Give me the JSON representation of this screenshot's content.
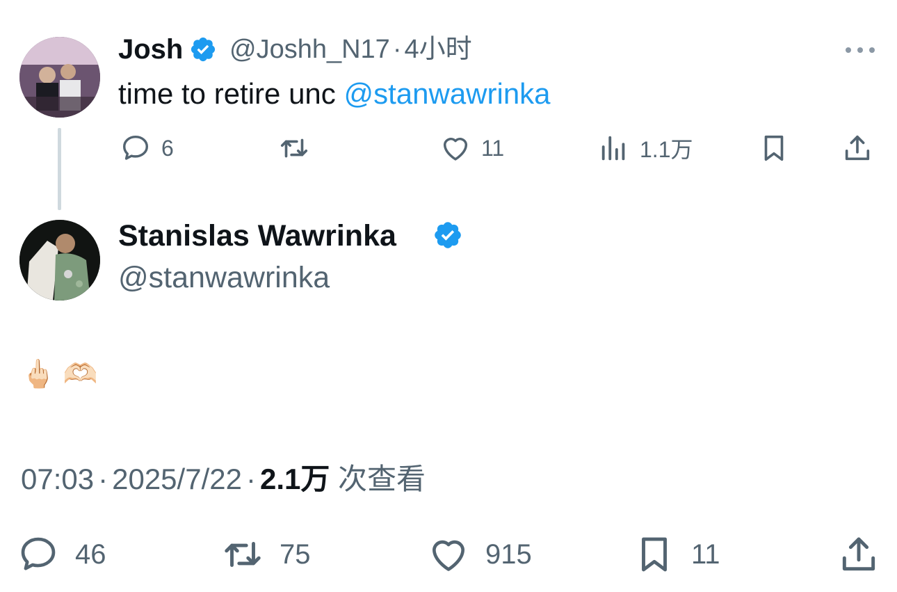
{
  "reply_tweet": {
    "author": {
      "name": "Josh",
      "handle": "@Joshh_N17",
      "separator": "·",
      "time": "4小时",
      "verified": true
    },
    "text_prefix": "time to retire unc ",
    "mention": "@stanwawrinka",
    "actions": {
      "replies": "6",
      "retweets": "",
      "likes": "11",
      "views": "1.1万"
    },
    "icons": [
      "more-icon",
      "reply-icon",
      "retweet-icon",
      "like-icon",
      "views-icon",
      "bookmark-icon",
      "share-icon"
    ]
  },
  "main_tweet": {
    "author": {
      "name": "Stanislas Wawrinka",
      "handle": "@stanwawrinka",
      "verified": true
    },
    "text": "🖕🏻 🫶🏻",
    "meta": {
      "time": "07:03",
      "sep1": "·",
      "date": "2025/7/22",
      "sep2": "·",
      "views_count": "2.1万",
      "views_label": " 次查看"
    },
    "actions": {
      "replies": "46",
      "retweets": "75",
      "likes": "915",
      "bookmarks": "11"
    }
  },
  "colors": {
    "text_primary": "#0f1419",
    "text_secondary": "#536471",
    "link": "#1d9bf0",
    "verified": "#1d9bf0",
    "thread_line": "#cfd9de"
  }
}
